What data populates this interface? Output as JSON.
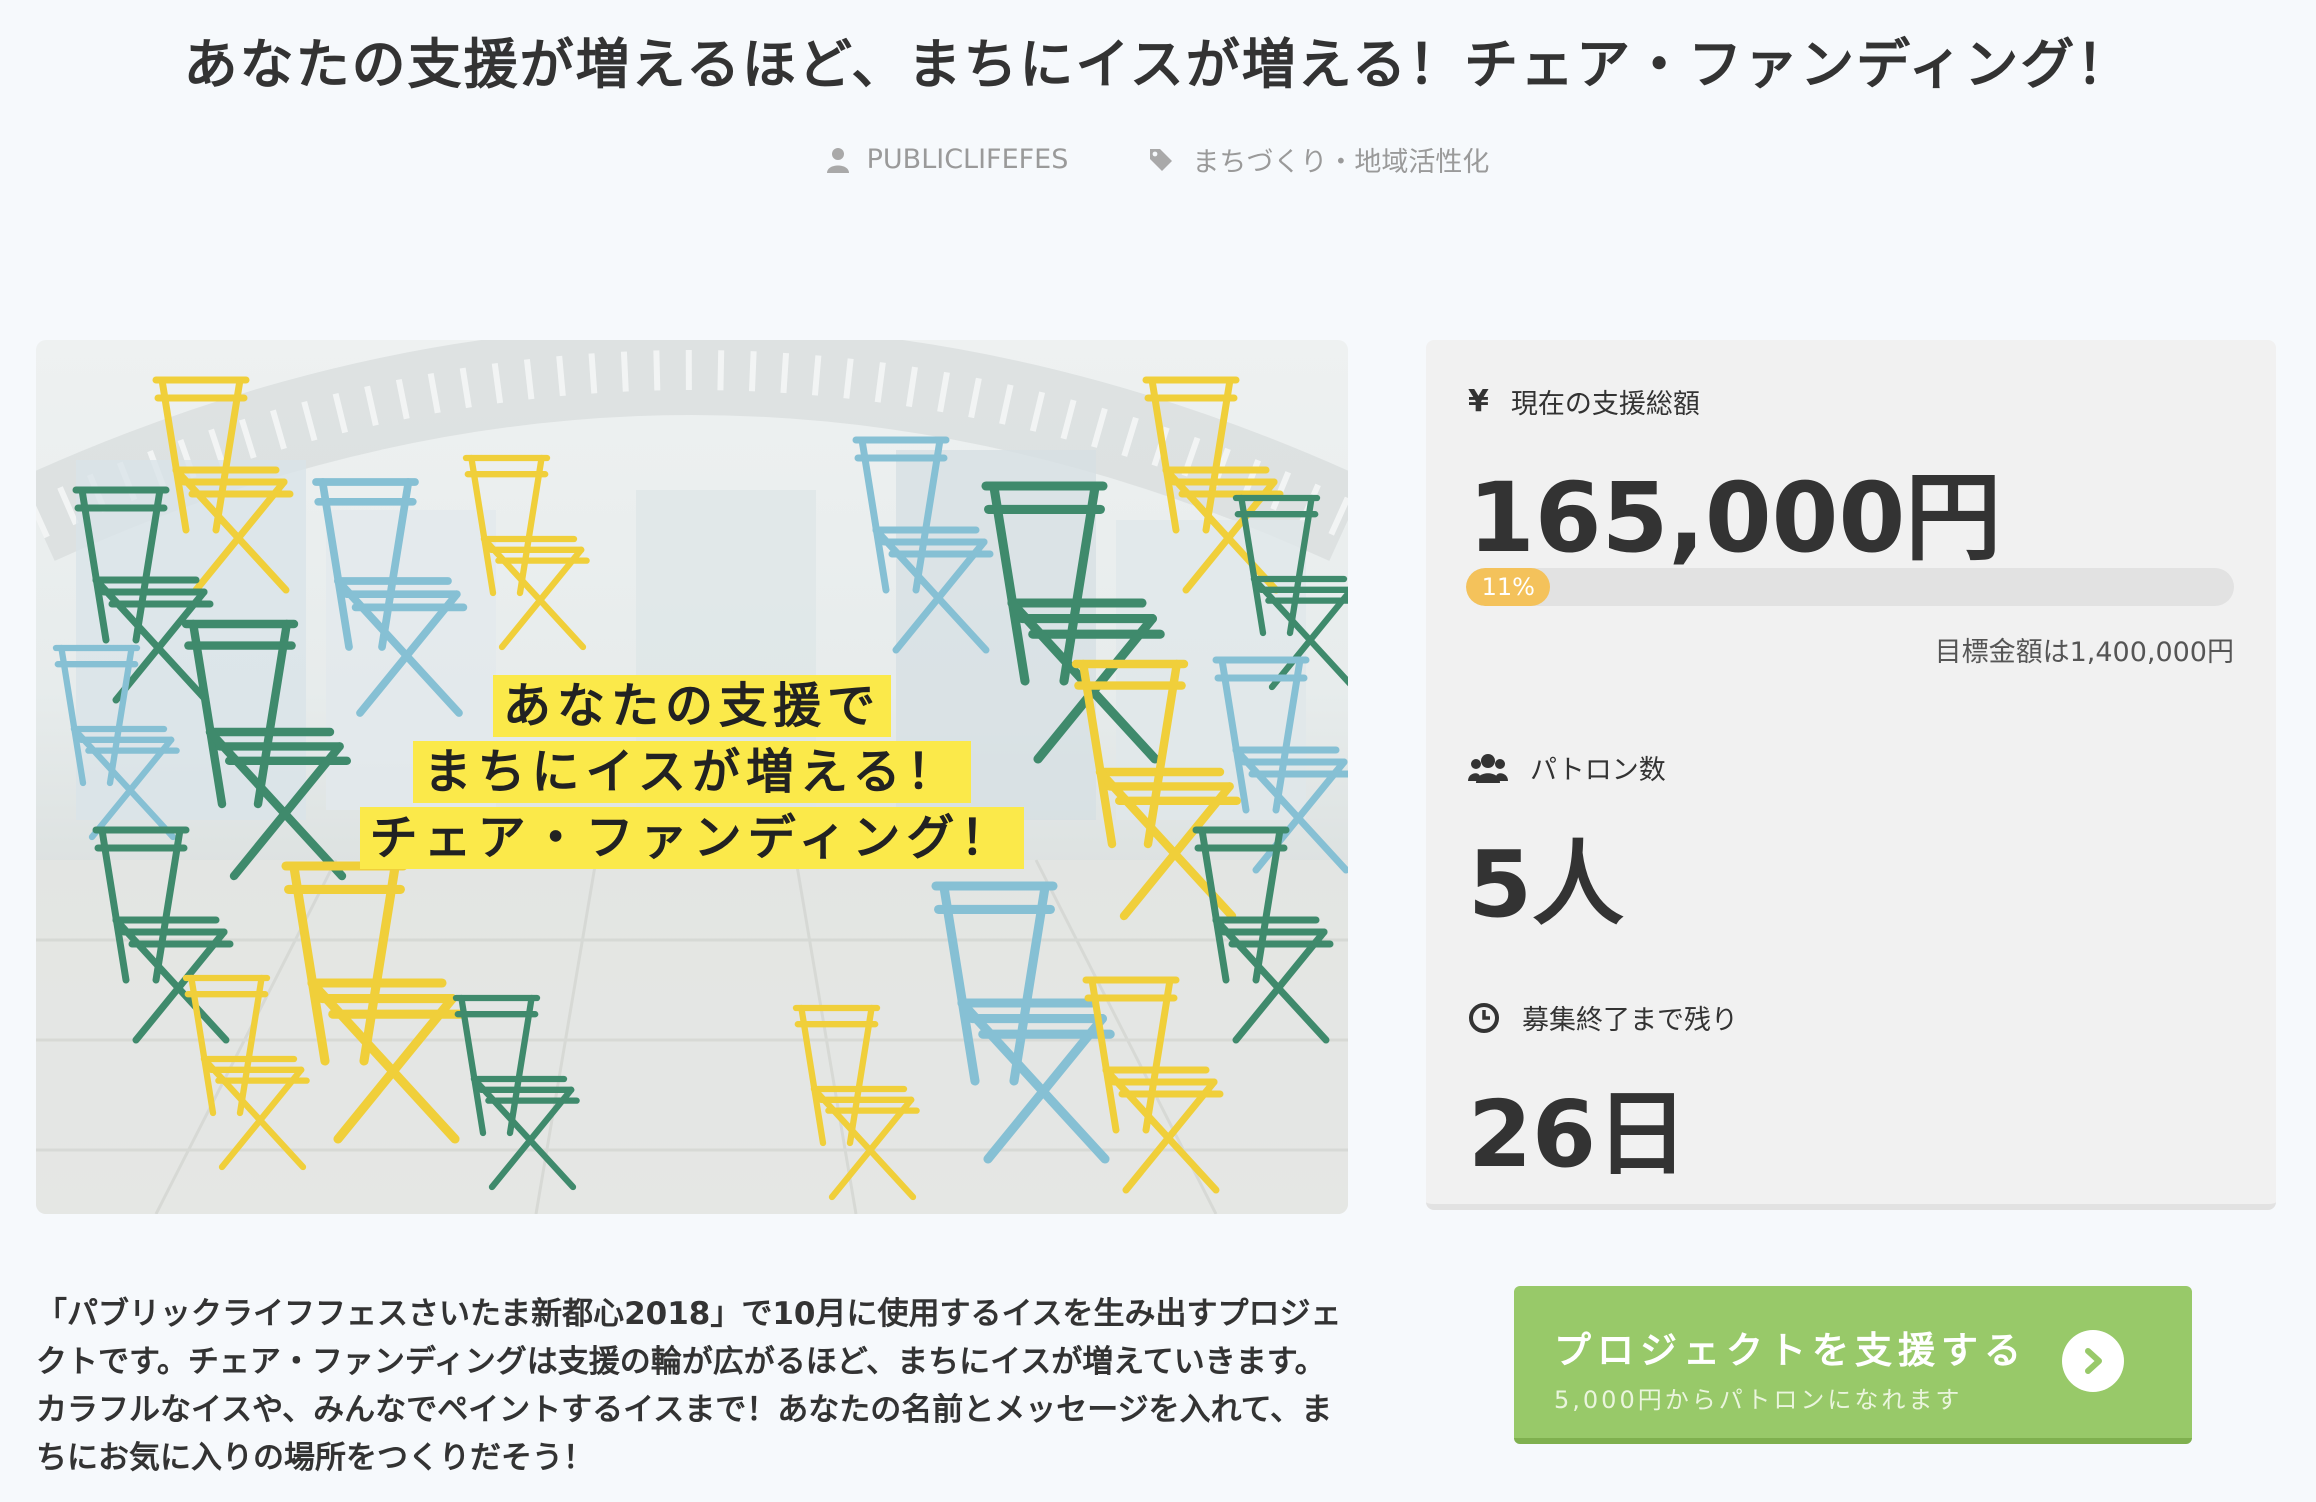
{
  "header": {
    "title": "あなたの支援が増えるほど、まちにイスが増える！チェア・ファンディング！",
    "author": "PUBLICLIFEFES",
    "category": "まちづくり・地域活性化",
    "author_icon": "user-icon",
    "category_icon": "tag-icon"
  },
  "hero": {
    "caption_lines": [
      "あなたの支援で",
      "まちにイスが増える！",
      "チェア・ファンディング！"
    ],
    "chair_colors": [
      "#f0cf3a",
      "#3f8a6c",
      "#86c0d4"
    ]
  },
  "stats": {
    "amount_label": "現在の支援総額",
    "amount_icon": "yen-icon",
    "amount_value": "165,000円",
    "progress_percent": 11,
    "progress_text": "11%",
    "goal_text": "目標金額は1,400,000円",
    "patrons_label": "パトロン数",
    "patrons_icon": "users-icon",
    "patrons_value": "5人",
    "remaining_label": "募集終了まで残り",
    "remaining_icon": "clock-icon",
    "remaining_value": "26日"
  },
  "description": "「パブリックライフフェスさいたま新都心2018」で10月に使用するイスを生み出すプロジェクトです。チェア・ファンディングは支援の輪が広がるほど、まちにイスが増えていきます。カラフルなイスや、みんなでペイントするイスまで！あなたの名前とメッセージを入れて、まちにお気に入りの場所をつくりだそう！",
  "cta": {
    "label": "プロジェクトを支援する",
    "sub_label": "5,000円からパトロンになれます",
    "icon": "chevron-right-circle-icon"
  },
  "colors": {
    "cta_green": "#98c969",
    "progress_fill": "#f4c25b",
    "highlight_yellow": "#fbe94a"
  }
}
